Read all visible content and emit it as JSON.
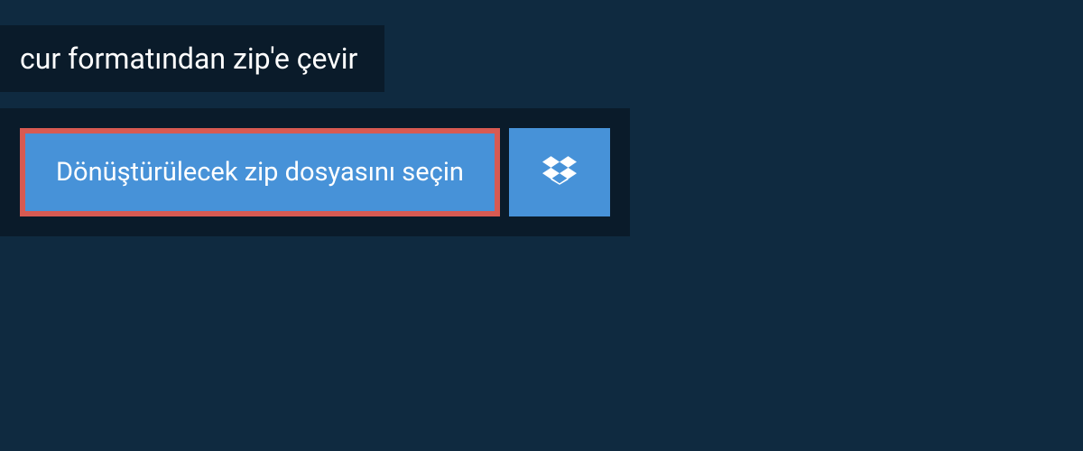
{
  "header": {
    "title": "cur formatından zip'e çevir"
  },
  "upload": {
    "select_button_label": "Dönüştürülecek zip dosyasını seçin",
    "dropbox_icon": "dropbox-icon"
  }
}
